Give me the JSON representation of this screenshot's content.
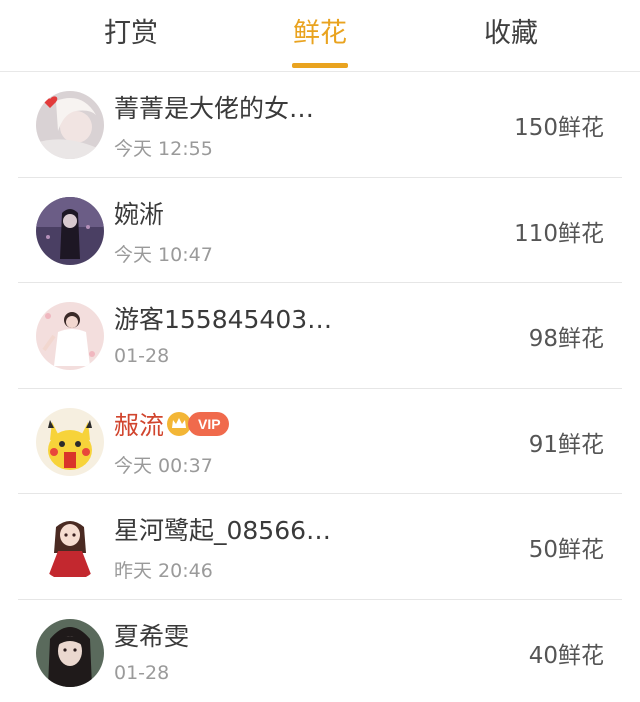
{
  "tabs": [
    {
      "label": "打赏",
      "active": false
    },
    {
      "label": "鲜花",
      "active": true
    },
    {
      "label": "收藏",
      "active": false
    }
  ],
  "colors": {
    "accent": "#e9a31f",
    "vip_name": "#d1452e",
    "vip_badge": "#f06a4c"
  },
  "rows": [
    {
      "name": "菁菁是大佬的女…",
      "time": "今天 12:55",
      "amount": "150鲜花",
      "avatar": "avatar-girl-with-heart"
    },
    {
      "name": "婉淅",
      "time": "今天 10:47",
      "amount": "110鲜花",
      "avatar": "avatar-dark-hair-girl"
    },
    {
      "name": "游客155845403…",
      "time": "01-28",
      "amount": "98鲜花",
      "avatar": "avatar-girl-white-dress"
    },
    {
      "name": "赧流",
      "time": "今天 00:37",
      "amount": "91鲜花",
      "avatar": "avatar-pikachu",
      "vip": true,
      "vip_label": "VIP",
      "crown_icon": "crown-icon"
    },
    {
      "name": "星河鹭起_08566…",
      "time": "昨天 20:46",
      "amount": "50鲜花",
      "avatar": "avatar-anime-girl-red-dress"
    },
    {
      "name": "夏希雯",
      "time": "01-28",
      "amount": "40鲜花",
      "avatar": "avatar-portrait-girl"
    }
  ]
}
